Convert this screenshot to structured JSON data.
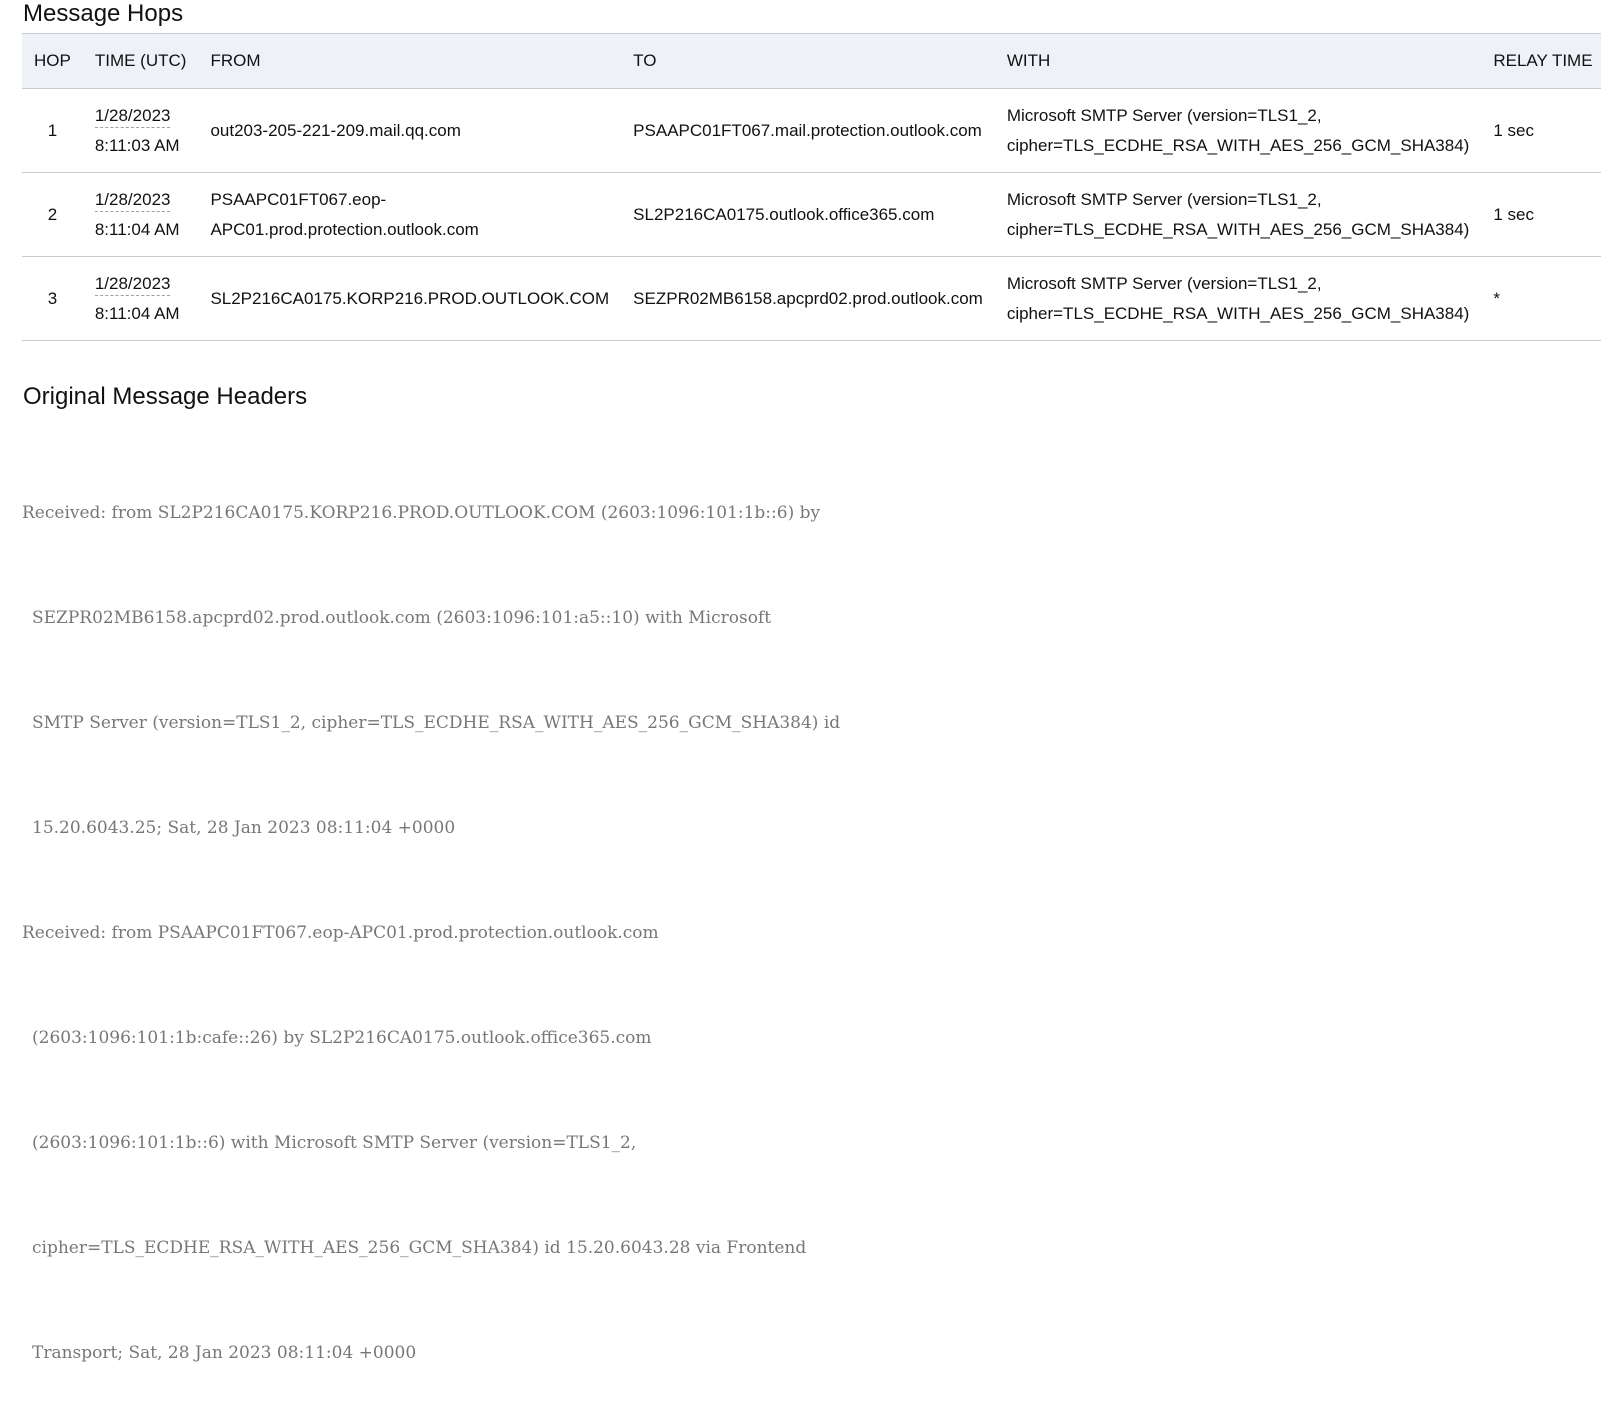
{
  "hops_section": {
    "title": "Message Hops",
    "columns": [
      "HOP",
      "TIME (UTC)",
      "FROM",
      "TO",
      "WITH",
      "RELAY TIME"
    ],
    "rows": [
      {
        "hop": "1",
        "date": "1/28/2023",
        "time": "8:11:03 AM",
        "from_lines": [
          "out203-205-221-209.mail.qq.com"
        ],
        "to": "PSAAPC01FT067.mail.protection.outlook.com",
        "with_lines": [
          "Microsoft SMTP Server (version=TLS1_2,",
          "cipher=TLS_ECDHE_RSA_WITH_AES_256_GCM_SHA384)"
        ],
        "relay": "1 sec"
      },
      {
        "hop": "2",
        "date": "1/28/2023",
        "time": "8:11:04 AM",
        "from_lines": [
          "PSAAPC01FT067.eop-",
          "APC01.prod.protection.outlook.com"
        ],
        "to": "SL2P216CA0175.outlook.office365.com",
        "with_lines": [
          "Microsoft SMTP Server (version=TLS1_2,",
          "cipher=TLS_ECDHE_RSA_WITH_AES_256_GCM_SHA384)"
        ],
        "relay": "1 sec"
      },
      {
        "hop": "3",
        "date": "1/28/2023",
        "time": "8:11:04 AM",
        "from_lines": [
          "SL2P216CA0175.KORP216.PROD.OUTLOOK.COM"
        ],
        "to": "SEZPR02MB6158.apcprd02.prod.outlook.com",
        "with_lines": [
          "Microsoft SMTP Server (version=TLS1_2,",
          "cipher=TLS_ECDHE_RSA_WITH_AES_256_GCM_SHA384)"
        ],
        "relay": "*"
      }
    ]
  },
  "headers_section": {
    "title": "Original Message Headers",
    "lines": [
      "Received: from SL2P216CA0175.KORP216.PROD.OUTLOOK.COM (2603:1096:101:1b::6) by",
      "SEZPR02MB6158.apcprd02.prod.outlook.com (2603:1096:101:a5::10) with Microsoft",
      "SMTP Server (version=TLS1_2, cipher=TLS_ECDHE_RSA_WITH_AES_256_GCM_SHA384) id",
      "15.20.6043.25; Sat, 28 Jan 2023 08:11:04 +0000",
      "Received: from PSAAPC01FT067.eop-APC01.prod.protection.outlook.com",
      "(2603:1096:101:1b:cafe::26) by SL2P216CA0175.outlook.office365.com",
      "(2603:1096:101:1b::6) with Microsoft SMTP Server (version=TLS1_2,",
      "cipher=TLS_ECDHE_RSA_WITH_AES_256_GCM_SHA384) id 15.20.6043.28 via Frontend",
      "Transport; Sat, 28 Jan 2023 08:11:04 +0000"
    ],
    "indented": [
      false,
      true,
      true,
      true,
      false,
      true,
      true,
      true,
      true
    ]
  },
  "colors": {
    "header_bg": "#eef2f8",
    "border": "#c8ccd2",
    "raw_header_text": "#777777"
  }
}
